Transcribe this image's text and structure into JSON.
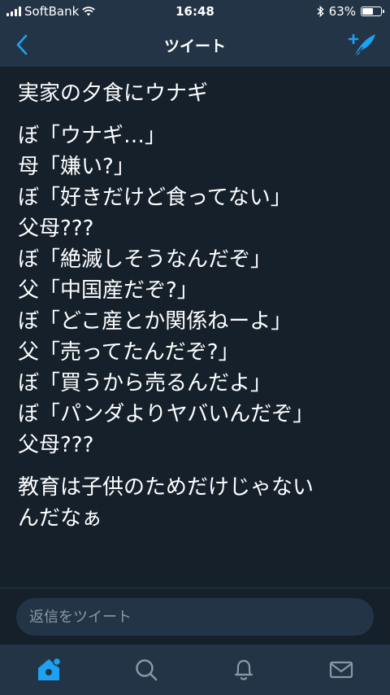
{
  "status_bar": {
    "carrier": "SoftBank",
    "time": "16:48",
    "battery_percent": "63%",
    "battery_level": 0.63
  },
  "nav": {
    "title": "ツイート"
  },
  "tweet": {
    "paragraphs": [
      [
        "実家の夕食にウナギ"
      ],
      [
        "ぼ「ウナギ…」",
        "母「嫌い?」",
        "ぼ「好きだけど食ってない」",
        "父母???",
        "ぼ「絶滅しそうなんだぞ」",
        "父「中国産だぞ?」",
        "ぼ「どこ産とか関係ねーよ」",
        "父「売ってたんだぞ?」",
        "ぼ「買うから売るんだよ」",
        "ぼ「パンダよりヤバいんだぞ」",
        "父母???"
      ],
      [
        "教育は子供のためだけじゃない",
        "んだなぁ"
      ]
    ]
  },
  "reply": {
    "placeholder": "返信をツイート",
    "value": ""
  },
  "tabs": [
    {
      "name": "home",
      "icon": "home-icon",
      "active": true
    },
    {
      "name": "search",
      "icon": "search-icon",
      "active": false
    },
    {
      "name": "notifications",
      "icon": "bell-icon",
      "active": false
    },
    {
      "name": "messages",
      "icon": "mail-icon",
      "active": false
    }
  ],
  "colors": {
    "background": "#15202b",
    "bar": "#243447",
    "accent": "#1da1f2",
    "muted": "#8899a6",
    "text": "#ffffff"
  }
}
